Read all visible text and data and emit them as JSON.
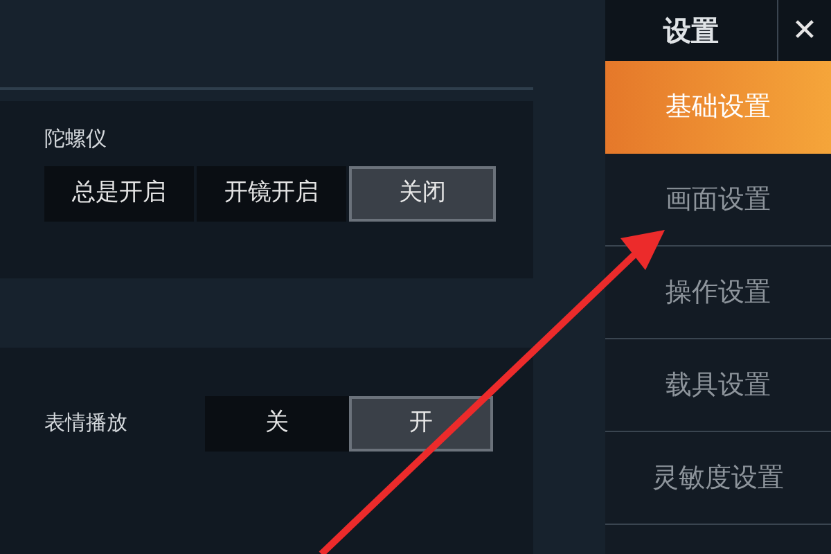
{
  "sections": [
    {
      "label": "陀螺仪",
      "options": [
        {
          "label": "总是开启",
          "selected": false
        },
        {
          "label": "开镜开启",
          "selected": false
        },
        {
          "label": "关闭",
          "selected": true
        }
      ]
    },
    {
      "label": "表情播放",
      "options": [
        {
          "label": "关",
          "selected": false
        },
        {
          "label": "开",
          "selected": true
        }
      ]
    }
  ],
  "sidebar": {
    "title": "设置",
    "close": "✕",
    "items": [
      {
        "label": "基础设置",
        "selected": true
      },
      {
        "label": "画面设置",
        "selected": false
      },
      {
        "label": "操作设置",
        "selected": false
      },
      {
        "label": "载具设置",
        "selected": false
      },
      {
        "label": "灵敏度设置",
        "selected": false
      }
    ]
  }
}
